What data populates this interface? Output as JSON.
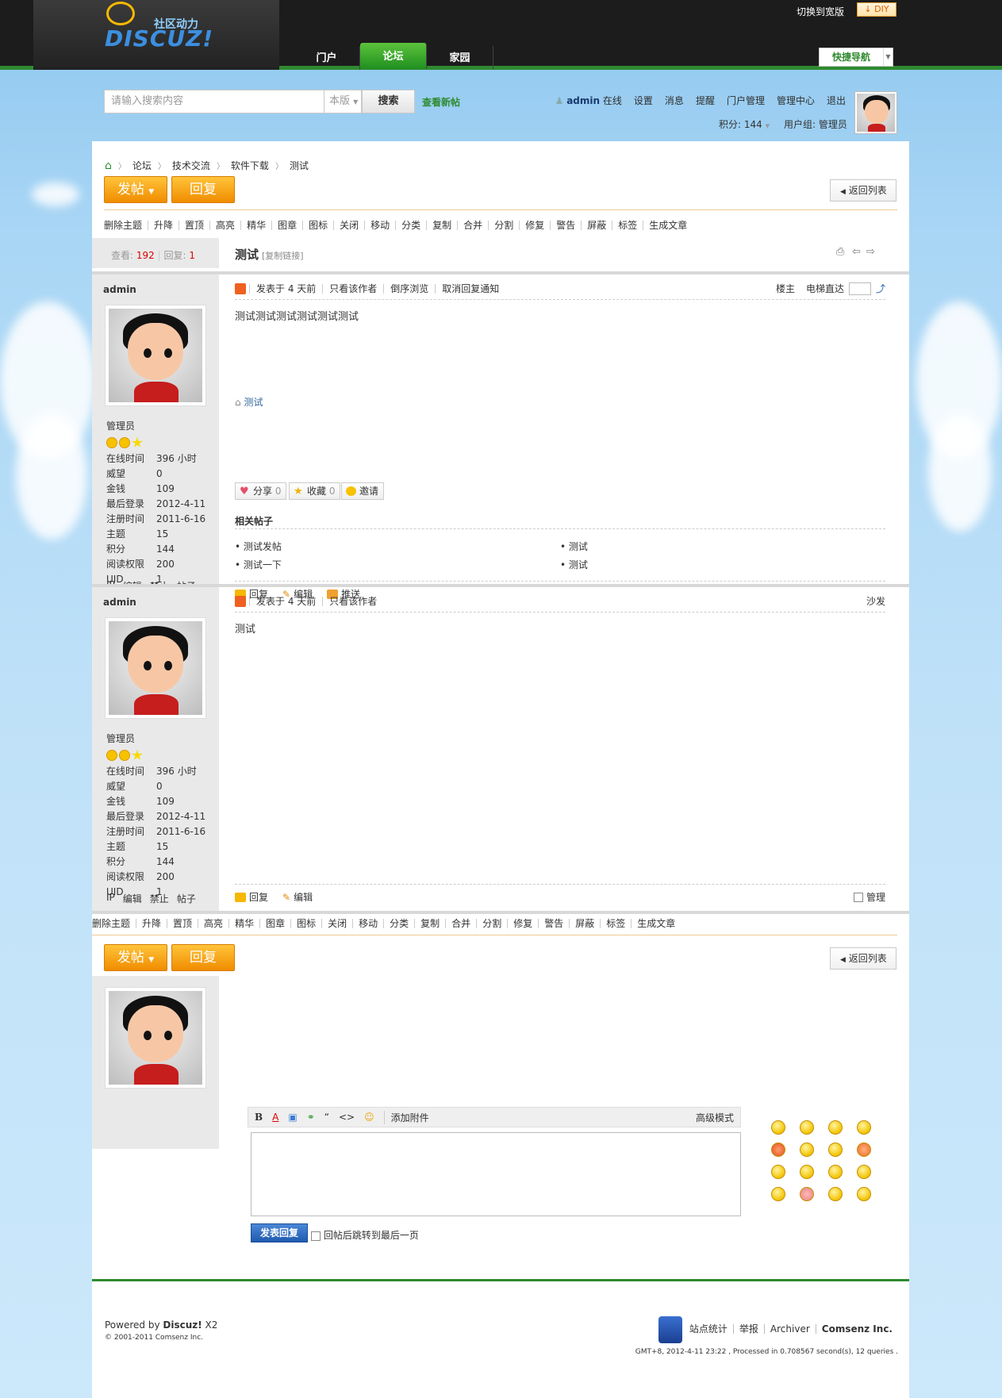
{
  "header": {
    "slogan": "社区动力",
    "brand": "DISCUZ!",
    "switch_wide": "切换到宽版",
    "diy": "DIY",
    "nav": [
      "门户",
      "论坛",
      "家园"
    ],
    "quick_nav": "快捷导航"
  },
  "search": {
    "placeholder": "请输入搜索内容",
    "scope": "本版",
    "button": "搜索",
    "view_new": "查看新帖"
  },
  "user": {
    "name": "admin",
    "status": "在线",
    "links": [
      "设置",
      "消息",
      "提醒",
      "门户管理",
      "管理中心",
      "退出"
    ],
    "score_label": "积分: 144",
    "group_label": "用户组: 管理员"
  },
  "breadcrumb": [
    "论坛",
    "技术交流",
    "软件下载",
    "测试"
  ],
  "actions": {
    "post": "发帖",
    "reply": "回复",
    "back": "返回列表"
  },
  "modtools": [
    "删除主题",
    "升降",
    "置顶",
    "高亮",
    "精华",
    "图章",
    "图标",
    "关闭",
    "移动",
    "分类",
    "复制",
    "合并",
    "分割",
    "修复",
    "警告",
    "屏蔽",
    "标签",
    "生成文章"
  ],
  "thread": {
    "views_label": "查看:",
    "views": "192",
    "replies_label": "回复:",
    "replies": "1",
    "title": "测试",
    "copy_link": "[复制链接]"
  },
  "author_profile": {
    "name": "admin",
    "group": "管理员",
    "stats": [
      {
        "k": "在线时间",
        "v": "396 小时"
      },
      {
        "k": "威望",
        "v": "0"
      },
      {
        "k": "金钱",
        "v": "109"
      },
      {
        "k": "最后登录",
        "v": "2012-4-11"
      },
      {
        "k": "注册时间",
        "v": "2011-6-16"
      },
      {
        "k": "主题",
        "v": "15"
      },
      {
        "k": "积分",
        "v": "144"
      },
      {
        "k": "阅读权限",
        "v": "200"
      },
      {
        "k": "UID",
        "v": "1"
      }
    ],
    "links": [
      "IP",
      "编辑",
      "禁止",
      "帖子"
    ]
  },
  "post1": {
    "posted": "发表于 4 天前",
    "only_author": "只看该作者",
    "reverse": "倒序浏览",
    "cancel_notify": "取消回复通知",
    "floor": "楼主",
    "jump": "电梯直达",
    "content": "测试测试测试测试测试测试",
    "tag": "测试",
    "share": "分享",
    "share_count": "0",
    "fav": "收藏",
    "fav_count": "0",
    "invite": "邀请",
    "related_title": "相关帖子",
    "related": [
      "测试发帖",
      "测试",
      "测试一下",
      "测试"
    ],
    "foot": [
      "回复",
      "编辑",
      "推送"
    ]
  },
  "post2": {
    "posted": "发表于 4 天前",
    "only_author": "只看该作者",
    "floor": "沙发",
    "content": "测试",
    "foot": [
      "回复",
      "编辑"
    ],
    "manage": "管理"
  },
  "editor": {
    "attach": "添加附件",
    "advanced": "高级模式",
    "submit": "发表回复",
    "jump_last": "回帖后跳转到最后一页"
  },
  "footer": {
    "powered_prefix": "Powered by ",
    "powered_brand": "Discuz!",
    "powered_ver": " X2",
    "copyright": "© 2001-2011 Comsenz Inc.",
    "links": [
      "站点统计",
      "举报",
      "Archiver"
    ],
    "company": "Comsenz Inc.",
    "gmt": "GMT+8, 2012-4-11 23:22 , Processed in 0.708567 second(s), 12 queries ."
  },
  "colors": {
    "brand_green": "#2f8a2f",
    "accent_orange": "#f08c00",
    "link_blue": "#336699"
  }
}
